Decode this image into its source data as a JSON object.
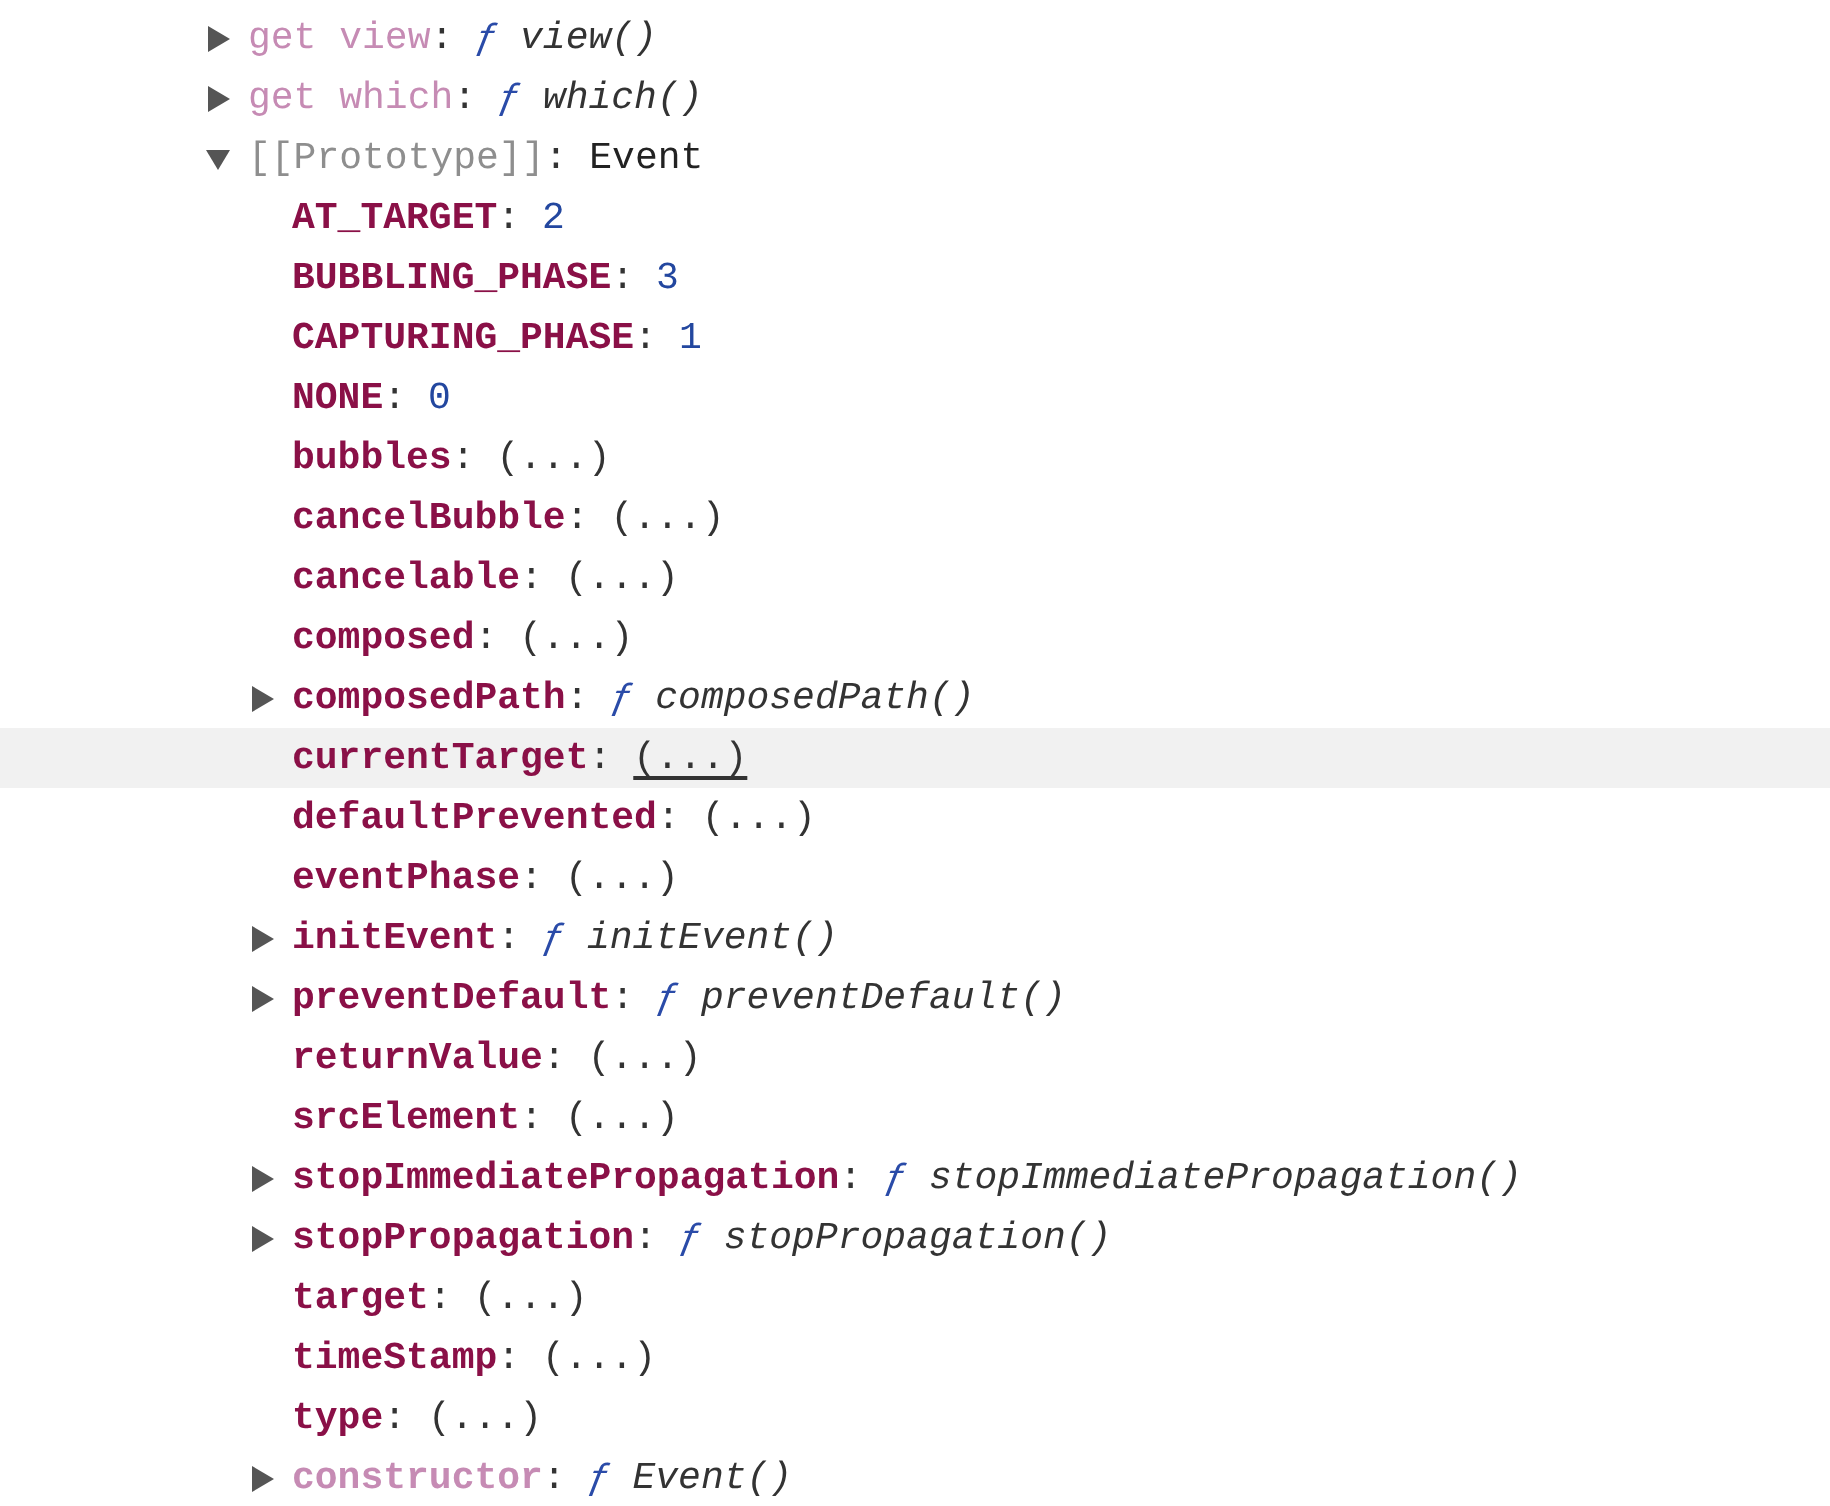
{
  "tree": [
    {
      "key": "get view",
      "bold": false,
      "dimmed": true,
      "internal": false,
      "separator": ":",
      "kind": "function",
      "function_sign": "ƒ",
      "value": "view()",
      "expanded": false,
      "hovered": false
    },
    {
      "key": "get which",
      "bold": false,
      "dimmed": true,
      "internal": false,
      "separator": ":",
      "kind": "function",
      "function_sign": "ƒ",
      "value": "which()",
      "expanded": false,
      "hovered": false
    },
    {
      "key": "[[Prototype]]",
      "bold": false,
      "dimmed": false,
      "internal": true,
      "separator": ":",
      "kind": "object",
      "value": "Event",
      "expanded": true,
      "hovered": false,
      "children": [
        {
          "key": "AT_TARGET",
          "bold": true,
          "dimmed": false,
          "internal": false,
          "separator": ":",
          "kind": "number",
          "value": "2",
          "hovered": false
        },
        {
          "key": "BUBBLING_PHASE",
          "bold": true,
          "dimmed": false,
          "internal": false,
          "separator": ":",
          "kind": "number",
          "value": "3",
          "hovered": false
        },
        {
          "key": "CAPTURING_PHASE",
          "bold": true,
          "dimmed": false,
          "internal": false,
          "separator": ":",
          "kind": "number",
          "value": "1",
          "hovered": false
        },
        {
          "key": "NONE",
          "bold": true,
          "dimmed": false,
          "internal": false,
          "separator": ":",
          "kind": "number",
          "value": "0",
          "hovered": false
        },
        {
          "key": "bubbles",
          "bold": true,
          "dimmed": false,
          "internal": false,
          "separator": ":",
          "kind": "lazy",
          "value": "(...)",
          "hovered": false
        },
        {
          "key": "cancelBubble",
          "bold": true,
          "dimmed": false,
          "internal": false,
          "separator": ":",
          "kind": "lazy",
          "value": "(...)",
          "hovered": false
        },
        {
          "key": "cancelable",
          "bold": true,
          "dimmed": false,
          "internal": false,
          "separator": ":",
          "kind": "lazy",
          "value": "(...)",
          "hovered": false
        },
        {
          "key": "composed",
          "bold": true,
          "dimmed": false,
          "internal": false,
          "separator": ":",
          "kind": "lazy",
          "value": "(...)",
          "hovered": false
        },
        {
          "key": "composedPath",
          "bold": true,
          "dimmed": false,
          "internal": false,
          "separator": ":",
          "kind": "function",
          "function_sign": "ƒ",
          "value": "composedPath()",
          "expanded": false,
          "hovered": false
        },
        {
          "key": "currentTarget",
          "bold": true,
          "dimmed": false,
          "internal": false,
          "separator": ":",
          "kind": "lazy",
          "value": "(...)",
          "hovered": true
        },
        {
          "key": "defaultPrevented",
          "bold": true,
          "dimmed": false,
          "internal": false,
          "separator": ":",
          "kind": "lazy",
          "value": "(...)",
          "hovered": false
        },
        {
          "key": "eventPhase",
          "bold": true,
          "dimmed": false,
          "internal": false,
          "separator": ":",
          "kind": "lazy",
          "value": "(...)",
          "hovered": false
        },
        {
          "key": "initEvent",
          "bold": true,
          "dimmed": false,
          "internal": false,
          "separator": ":",
          "kind": "function",
          "function_sign": "ƒ",
          "value": "initEvent()",
          "expanded": false,
          "hovered": false
        },
        {
          "key": "preventDefault",
          "bold": true,
          "dimmed": false,
          "internal": false,
          "separator": ":",
          "kind": "function",
          "function_sign": "ƒ",
          "value": "preventDefault()",
          "expanded": false,
          "hovered": false
        },
        {
          "key": "returnValue",
          "bold": true,
          "dimmed": false,
          "internal": false,
          "separator": ":",
          "kind": "lazy",
          "value": "(...)",
          "hovered": false
        },
        {
          "key": "srcElement",
          "bold": true,
          "dimmed": false,
          "internal": false,
          "separator": ":",
          "kind": "lazy",
          "value": "(...)",
          "hovered": false
        },
        {
          "key": "stopImmediatePropagation",
          "bold": true,
          "dimmed": false,
          "internal": false,
          "separator": ":",
          "kind": "function",
          "function_sign": "ƒ",
          "value": "stopImmediatePropagation()",
          "expanded": false,
          "hovered": false
        },
        {
          "key": "stopPropagation",
          "bold": true,
          "dimmed": false,
          "internal": false,
          "separator": ":",
          "kind": "function",
          "function_sign": "ƒ",
          "value": "stopPropagation()",
          "expanded": false,
          "hovered": false
        },
        {
          "key": "target",
          "bold": true,
          "dimmed": false,
          "internal": false,
          "separator": ":",
          "kind": "lazy",
          "value": "(...)",
          "hovered": false
        },
        {
          "key": "timeStamp",
          "bold": true,
          "dimmed": false,
          "internal": false,
          "separator": ":",
          "kind": "lazy",
          "value": "(...)",
          "hovered": false
        },
        {
          "key": "type",
          "bold": true,
          "dimmed": false,
          "internal": false,
          "separator": ":",
          "kind": "lazy",
          "value": "(...)",
          "hovered": false
        },
        {
          "key": "constructor",
          "bold": true,
          "dimmed": true,
          "internal": false,
          "separator": ":",
          "kind": "function",
          "function_sign": "ƒ",
          "value": "Event()",
          "expanded": false,
          "hovered": false
        }
      ]
    }
  ]
}
